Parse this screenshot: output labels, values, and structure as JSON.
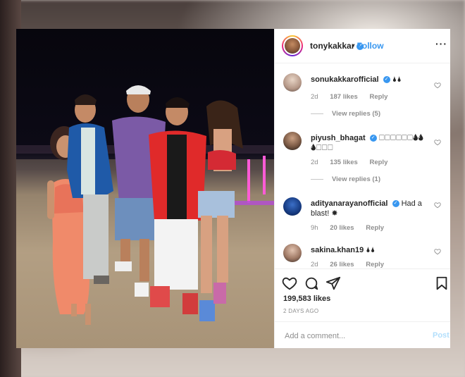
{
  "post": {
    "author": {
      "handle": "tonykakkar",
      "verified": true,
      "follow_sep": "•",
      "follow_label": "Follow"
    },
    "more_icon": "···",
    "comments": [
      {
        "user": "sonukakkarofficial",
        "text": "🌢🌢",
        "age": "2d",
        "likes": "187 likes",
        "reply": "Reply",
        "view_replies": "View replies (5)"
      },
      {
        "user": "piyush_bhagat",
        "text": "🗆🗆🗆🗆🗆🗆🌢🌢🌢🗆🗆🗆",
        "age": "2d",
        "likes": "135 likes",
        "reply": "Reply",
        "view_replies": "View replies (1)"
      },
      {
        "user": "adityanarayanofficial",
        "text": "Had a blast! ✸",
        "age": "9h",
        "likes": "20 likes",
        "reply": "Reply"
      },
      {
        "user": "sakina.khan19",
        "text": "🌢🌢",
        "age": "2d",
        "likes": "26 likes",
        "reply": "Reply"
      }
    ],
    "likes": "199,583 likes",
    "posted": "2 DAYS AGO",
    "add_comment_placeholder": "Add a comment...",
    "post_button": "Post"
  },
  "colors": {
    "accent": "#3897f0",
    "text": "#262626",
    "muted": "#8e8e8e"
  }
}
